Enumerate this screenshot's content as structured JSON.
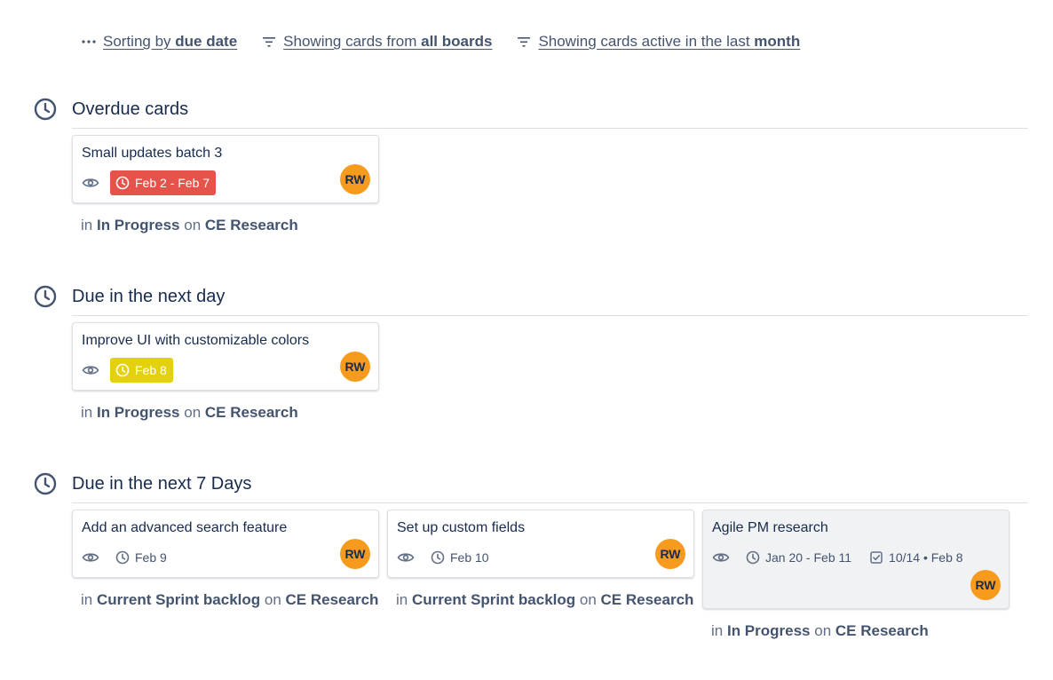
{
  "toolbar": {
    "sort": {
      "prefix": "Sorting by ",
      "bold": "due date"
    },
    "boards": {
      "prefix": "Showing cards from ",
      "bold": "all boards"
    },
    "active": {
      "prefix": "Showing cards active in the last ",
      "bold": "month"
    }
  },
  "sections": {
    "overdue": {
      "title": "Overdue cards",
      "cards": [
        {
          "title": "Small updates batch 3",
          "date": "Feb 2 - Feb 7",
          "avatar": "RW",
          "loc_in": "in ",
          "list": "In Progress",
          "loc_on": " on ",
          "board": "CE Research"
        }
      ]
    },
    "next_day": {
      "title": "Due in the next day",
      "cards": [
        {
          "title": "Improve UI with customizable colors",
          "date": "Feb 8",
          "avatar": "RW",
          "loc_in": "in ",
          "list": "In Progress",
          "loc_on": " on ",
          "board": "CE Research"
        }
      ]
    },
    "next_7": {
      "title": "Due in the next 7 Days",
      "cards": [
        {
          "title": "Add an advanced search feature",
          "date": "Feb 9",
          "avatar": "RW",
          "loc_in": "in ",
          "list": "Current Sprint backlog",
          "loc_on": " on ",
          "board": "CE Research"
        },
        {
          "title": "Set up custom fields",
          "date": "Feb 10",
          "avatar": "RW",
          "loc_in": "in ",
          "list": "Current Sprint backlog",
          "loc_on": " on ",
          "board": "CE Research"
        },
        {
          "title": "Agile PM research",
          "date": "Jan 20 - Feb 11",
          "checklist": "10/14 • Feb 8",
          "avatar": "RW",
          "loc_in": "in ",
          "list": "In Progress",
          "loc_on": " on ",
          "board": "CE Research"
        }
      ]
    }
  },
  "colors": {
    "overdue": "#e5534b",
    "due_soon": "#e2d10b",
    "avatar": "#f79b1e"
  },
  "icons": [
    "more-icon",
    "filter-icon",
    "clock-icon",
    "eye-icon",
    "checklist-icon"
  ]
}
